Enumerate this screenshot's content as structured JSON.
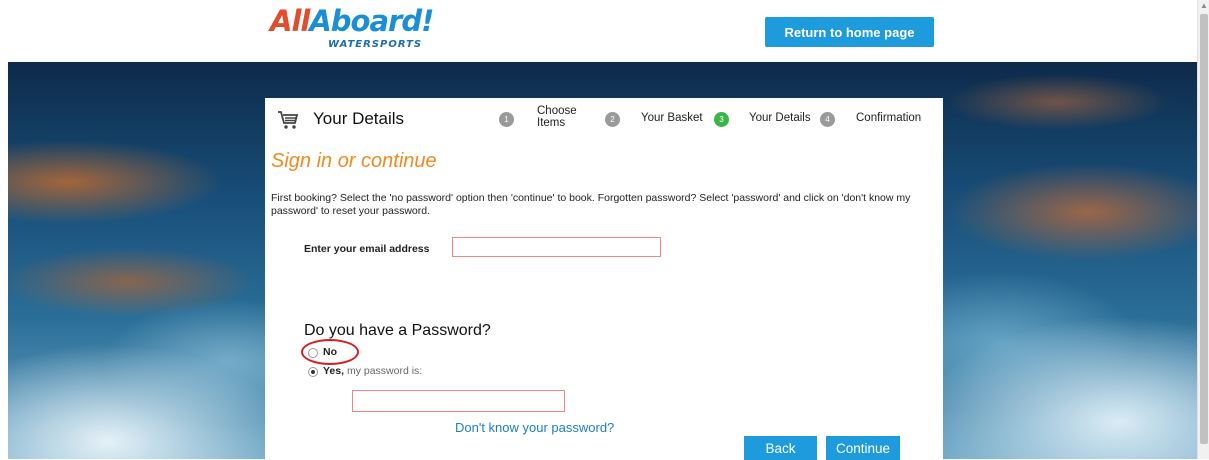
{
  "header": {
    "logo_main_a": "All",
    "logo_main_b": "Aboard!",
    "logo_sub": "WATERSPORTS",
    "home_button": "Return to home page"
  },
  "panel": {
    "title": "Your Details",
    "steps": [
      {
        "num": "1",
        "label": "Choose Items"
      },
      {
        "num": "2",
        "label": "Your Basket"
      },
      {
        "num": "3",
        "label": "Your Details",
        "active": true
      },
      {
        "num": "4",
        "label": "Confirmation"
      }
    ],
    "heading": "Sign in or continue",
    "intro": "First booking? Select the 'no password' option then 'continue' to book. Forgotten password? Select 'password' and click on 'don't know my password' to reset your password.",
    "email_label": "Enter your email address",
    "email_value": "",
    "password_question": "Do you have a Password?",
    "option_no": "No",
    "option_yes": "Yes,",
    "option_yes_sub": " my password is:",
    "password_value": "",
    "forgot_link": "Don't know your password?",
    "back_button": "Back",
    "continue_button": "Continue"
  },
  "colors": {
    "accent": "#1d9bdc",
    "heading_orange": "#f28a1f",
    "active_step": "#3bb54a",
    "annotation": "#d62020"
  },
  "icons": [
    "cart-icon",
    "scroll-up-icon"
  ]
}
